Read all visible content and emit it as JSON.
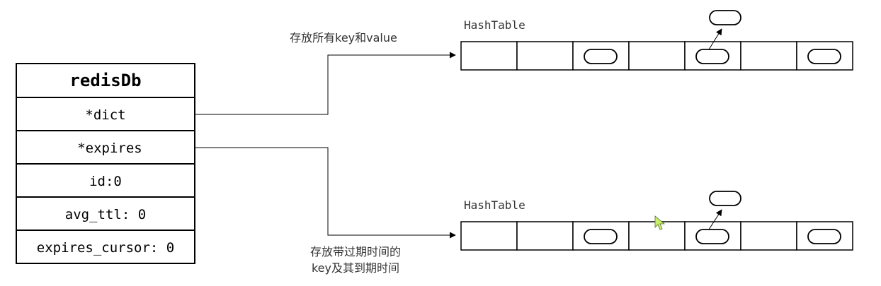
{
  "struct": {
    "title": "redisDb",
    "fields": [
      "*dict",
      "*expires",
      "id:0",
      "avg_ttl: 0",
      "expires_cursor: 0"
    ]
  },
  "tables": [
    {
      "label": "HashTable",
      "slots": [
        false,
        false,
        true,
        false,
        true,
        false,
        true
      ],
      "chained_slot": 4
    },
    {
      "label": "HashTable",
      "slots": [
        false,
        false,
        true,
        false,
        true,
        false,
        true
      ],
      "chained_slot": 4
    }
  ],
  "annotations": {
    "dict": "存放所有key和value",
    "expires_line1": "存放带过期时间的",
    "expires_line2": "key及其到期时间"
  }
}
